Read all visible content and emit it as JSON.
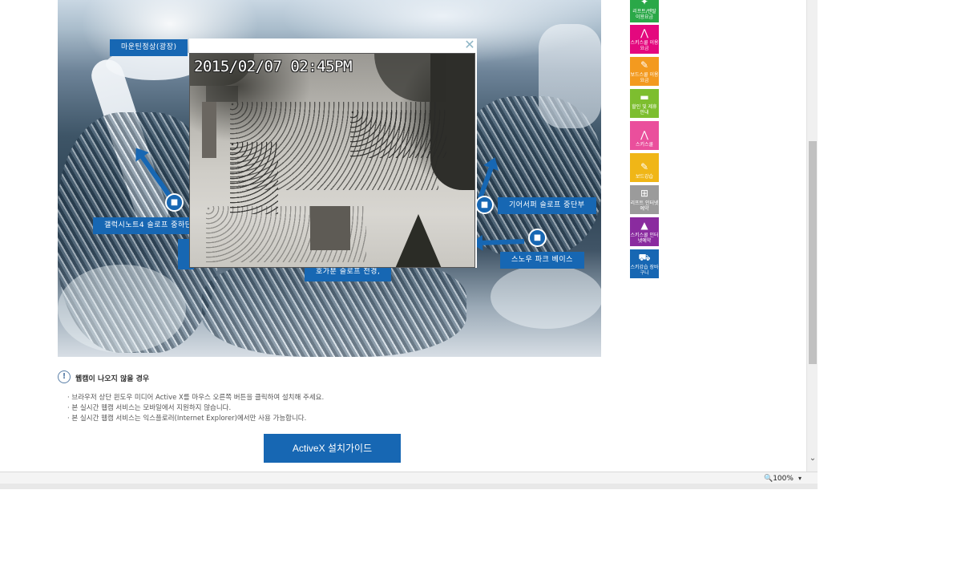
{
  "map": {
    "labels": {
      "mountain_top": "마운틴정상(광장)",
      "galaxy": "갤럭시노트4 슬로프 중하단",
      "gear": "기어서퍼 슬로프 중단부",
      "snowpark": "스노우 파크 베이스",
      "hogaboon": "호가분 슬로프 전경,"
    }
  },
  "popup": {
    "close_symbol": "✕",
    "timestamp": "2015/02/07 02:45PM"
  },
  "quick_menu": [
    {
      "label": "리프트/렌탈 이용요금",
      "color": "#2aa848",
      "icon": "lift-rental-icon"
    },
    {
      "label": "스키스쿨 이용요금",
      "color": "#e4087e",
      "icon": "ski-school-fee-icon"
    },
    {
      "label": "보드스쿨 이용요금",
      "color": "#f39a1f",
      "icon": "board-school-fee-icon"
    },
    {
      "label": "할인 및 제휴안내",
      "color": "#7dbe2f",
      "icon": "discount-card-icon"
    },
    {
      "label": "스키스쿨",
      "color": "#ea4f9c",
      "icon": "ski-school-icon"
    },
    {
      "label": "보드강습",
      "color": "#f0b617",
      "icon": "board-lesson-icon"
    },
    {
      "label": "리프트 인터넷예약",
      "color": "#9b9b9b",
      "icon": "lift-reserve-icon"
    },
    {
      "label": "스키스쿨 인터넷예약",
      "color": "#8a2b9f",
      "icon": "ski-school-reserve-icon"
    },
    {
      "label": "스키강습 장바구니",
      "color": "#1767b3",
      "icon": "cart-icon"
    }
  ],
  "help": {
    "icon_symbol": "!",
    "title": "웹캠이 나오지 않을 경우",
    "lines": [
      "브라우저 상단 윈도우 미디어 Active X를 마우스 오른쪽 버튼을 클릭하여 설치해 주세요.",
      "본 실시간 웹캠 서비스는 모바일에서 지원하지 않습니다.",
      "본 실시간 웹캠 서비스는 익스플로러(Internet Explorer)에서만 사용 가능합니다."
    ],
    "button_label": "ActiveX 설치가이드"
  },
  "statusbar": {
    "zoom": "🔍100%",
    "zoom_dropdown": "▾"
  },
  "scroll": {
    "down_symbol": "⌄"
  },
  "cam_glyph": "■"
}
